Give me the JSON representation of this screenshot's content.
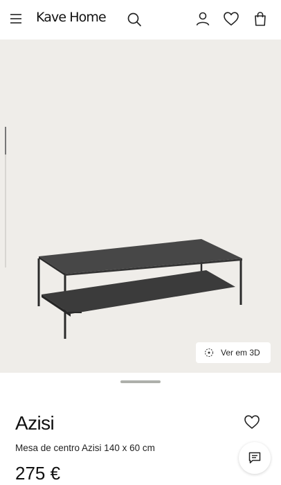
{
  "header": {
    "brand": "Kave Home",
    "icons": [
      "menu-icon",
      "search-icon",
      "user-icon",
      "heart-icon",
      "bag-icon"
    ]
  },
  "gallery": {
    "view_3d_label": "Ver em 3D"
  },
  "product": {
    "name": "Azisi",
    "subtitle": "Mesa de centro Azisi 140 x 60 cm",
    "price": "275 €"
  },
  "colors": {
    "hero_background": "#efede9",
    "text": "#111111",
    "product_dark": "#3a3a3a"
  }
}
